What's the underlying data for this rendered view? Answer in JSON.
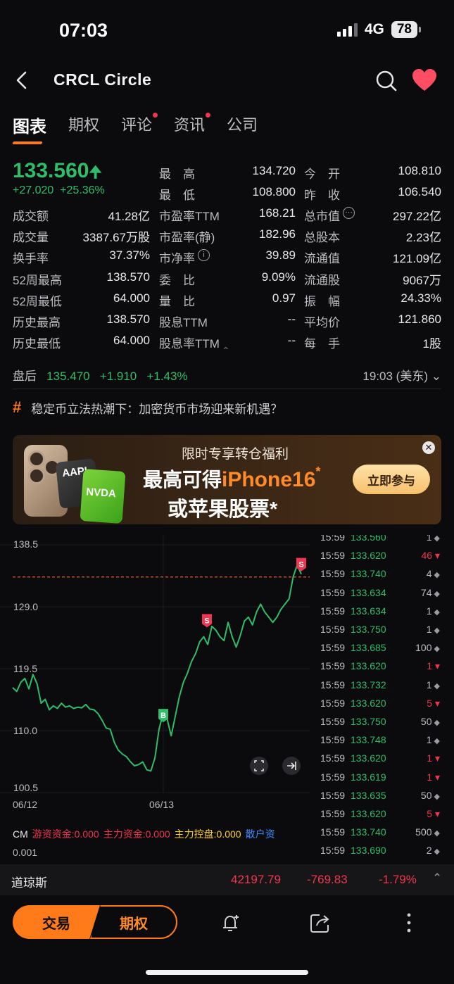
{
  "status": {
    "time": "07:03",
    "network": "4G",
    "battery": "78"
  },
  "header": {
    "title": "CRCL  Circle"
  },
  "tabs": [
    {
      "label": "图表",
      "active": true,
      "dot": false
    },
    {
      "label": "期权",
      "active": false,
      "dot": false
    },
    {
      "label": "评论",
      "active": false,
      "dot": true
    },
    {
      "label": "资讯",
      "active": false,
      "dot": true
    },
    {
      "label": "公司",
      "active": false,
      "dot": false
    }
  ],
  "quote": {
    "price": "133.560",
    "change": "+27.020",
    "change_pct": "+25.36%"
  },
  "stats": {
    "col1": [
      {
        "label": "成交额",
        "value": "41.28亿"
      },
      {
        "label": "成交量",
        "value": "3387.67万股"
      },
      {
        "label": "换手率",
        "value": "37.37%"
      },
      {
        "label": "52周最高",
        "value": "138.570"
      },
      {
        "label": "52周最低",
        "value": "64.000"
      },
      {
        "label": "历史最高",
        "value": "138.570"
      },
      {
        "label": "历史最低",
        "value": "64.000"
      }
    ],
    "col2": [
      {
        "label": "最　高",
        "value": "134.720",
        "color": "green"
      },
      {
        "label": "最　低",
        "value": "108.800",
        "color": "green"
      },
      {
        "label": "市盈率TTM",
        "value": "168.21"
      },
      {
        "label": "市盈率(静)",
        "value": "182.96"
      },
      {
        "label": "市净率",
        "value": "39.89",
        "info": true
      },
      {
        "label": "委　比",
        "value": "9.09%"
      },
      {
        "label": "量　比",
        "value": "0.97"
      },
      {
        "label": "股息TTM",
        "value": "--"
      },
      {
        "label": "股息率TTM",
        "value": "--"
      }
    ],
    "col3": [
      {
        "label": "今　开",
        "value": "108.810",
        "color": "green"
      },
      {
        "label": "昨　收",
        "value": "106.540"
      },
      {
        "label": "总市值",
        "value": "297.22亿",
        "info": true
      },
      {
        "label": "总股本",
        "value": "2.23亿"
      },
      {
        "label": "流通值",
        "value": "121.09亿"
      },
      {
        "label": "流通股",
        "value": "9067万"
      },
      {
        "label": "振　幅",
        "value": "24.33%"
      },
      {
        "label": "平均价",
        "value": "121.860"
      },
      {
        "label": "每　手",
        "value": "1股"
      }
    ]
  },
  "after_hours": {
    "label": "盘后",
    "price": "135.470",
    "change": "+1.910",
    "pct": "+1.43%",
    "time": "19:03 (美东)"
  },
  "news": {
    "text": "稳定币立法热潮下：加密货币市场迎来新机遇？"
  },
  "banner": {
    "sub": "限时专享转仓福利",
    "main_prefix": "最高可得",
    "main_highlight": "iPhone16",
    "star": "*",
    "line2": "或苹果股票*",
    "button": "立即参与",
    "aapl": "AAPL",
    "nvda": "NVDA"
  },
  "chart_data": {
    "type": "line",
    "title": "",
    "y_ticks": [
      "138.5",
      "129.0",
      "119.5",
      "110.0",
      "100.5"
    ],
    "x_ticks": [
      "06/12",
      "06/13"
    ],
    "ylim": [
      100.5,
      138.5
    ],
    "markers": [
      "S",
      "S",
      "B"
    ],
    "series": [
      {
        "values": [
          116.6,
          116.0,
          117.4,
          118.0,
          116.4,
          118.6,
          117.2,
          114.2,
          114.8,
          113.2,
          113.8,
          113.4,
          114.2,
          113.6,
          113.8,
          113.4,
          113.6,
          113.5,
          114.0,
          113.3,
          113.2,
          112.6,
          111.6,
          110.4,
          110.2,
          108.2,
          107.0,
          106.4,
          106.0,
          105.2,
          104.6,
          104.8,
          105.2,
          104.0,
          103.8,
          105.8,
          110.2,
          112.6,
          111.8,
          109.2,
          112.2,
          115.2,
          117.4,
          118.8,
          120.6,
          121.8,
          123.6,
          124.4,
          123.2,
          126.0,
          125.4,
          124.4,
          123.8,
          126.6,
          124.4,
          122.8,
          124.6,
          126.8,
          127.4,
          126.2,
          128.2,
          129.4,
          128.2,
          127.4,
          126.6,
          127.4,
          128.6,
          129.4,
          130.2,
          133.6,
          135.4,
          134.0
        ]
      }
    ],
    "reference_line": 133.56
  },
  "ticks": [
    {
      "time": "15:59",
      "price": "133.560",
      "vol": "1",
      "dir": "neutral"
    },
    {
      "time": "15:59",
      "price": "133.620",
      "vol": "46",
      "dir": "down"
    },
    {
      "time": "15:59",
      "price": "133.740",
      "vol": "4",
      "dir": "neutral"
    },
    {
      "time": "15:59",
      "price": "133.634",
      "vol": "74",
      "dir": "neutral"
    },
    {
      "time": "15:59",
      "price": "133.634",
      "vol": "1",
      "dir": "neutral"
    },
    {
      "time": "15:59",
      "price": "133.750",
      "vol": "1",
      "dir": "neutral"
    },
    {
      "time": "15:59",
      "price": "133.685",
      "vol": "100",
      "dir": "neutral"
    },
    {
      "time": "15:59",
      "price": "133.620",
      "vol": "1",
      "dir": "down"
    },
    {
      "time": "15:59",
      "price": "133.732",
      "vol": "1",
      "dir": "neutral"
    },
    {
      "time": "15:59",
      "price": "133.620",
      "vol": "5",
      "dir": "down"
    },
    {
      "time": "15:59",
      "price": "133.750",
      "vol": "50",
      "dir": "neutral"
    },
    {
      "time": "15:59",
      "price": "133.748",
      "vol": "1",
      "dir": "neutral"
    },
    {
      "time": "15:59",
      "price": "133.620",
      "vol": "1",
      "dir": "down"
    },
    {
      "time": "15:59",
      "price": "133.619",
      "vol": "1",
      "dir": "down"
    },
    {
      "time": "15:59",
      "price": "133.635",
      "vol": "50",
      "dir": "neutral"
    },
    {
      "time": "15:59",
      "price": "133.620",
      "vol": "5",
      "dir": "down"
    },
    {
      "time": "15:59",
      "price": "133.740",
      "vol": "500",
      "dir": "neutral"
    },
    {
      "time": "15:59",
      "price": "133.690",
      "vol": "2",
      "dir": "neutral"
    }
  ],
  "indicator": {
    "name": "CM",
    "items": [
      {
        "text": "游资资金:0.000",
        "color": "#f0364e"
      },
      {
        "text": "主力资金:0.000",
        "color": "#f0364e"
      },
      {
        "text": "主力控盘:0.000",
        "color": "#ffd21f"
      },
      {
        "text": "散户资",
        "color": "#3a8bff"
      }
    ],
    "axis_value": "0.001"
  },
  "index_bar": {
    "name": "道琼斯",
    "value": "42197.79",
    "change": "-769.83",
    "pct": "-1.79%"
  },
  "bottom": {
    "trade": "交易",
    "options": "期权"
  }
}
